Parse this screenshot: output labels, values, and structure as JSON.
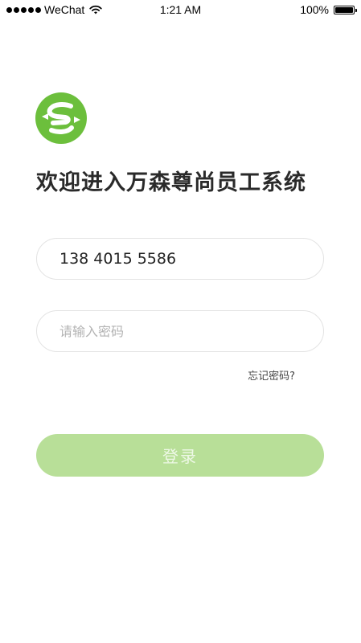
{
  "status_bar": {
    "carrier": "WeChat",
    "time": "1:21 AM",
    "battery": "100%",
    "signal_icon": "signal-dots-icon",
    "wifi_icon": "wifi-icon",
    "battery_icon": "battery-icon",
    "battery_level": 1.0
  },
  "logo": {
    "icon": "logo-icon",
    "color": "#6cbf3c"
  },
  "title": "欢迎进入万森尊尚员工系统",
  "form": {
    "phone_value": "138 4015 5586",
    "password_value": "",
    "password_placeholder": "请输入密码",
    "forgot_label": "忘记密码?",
    "login_label": "登录"
  },
  "colors": {
    "accent": "#6cbf3c",
    "button_disabled": "#b8df98",
    "input_border": "#e3e3e3"
  }
}
